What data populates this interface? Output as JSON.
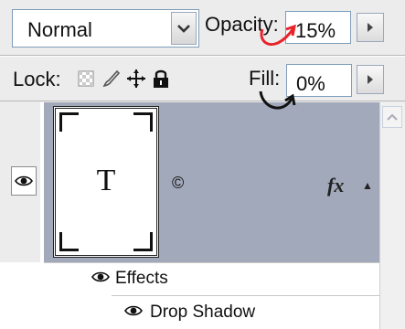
{
  "blend_mode": {
    "value": "Normal"
  },
  "opacity": {
    "label": "Opacity:",
    "value": "15%"
  },
  "lock": {
    "label": "Lock:"
  },
  "fill": {
    "label": "Fill:",
    "value": "0%"
  },
  "layer": {
    "thumbnail_text": "T",
    "name": "©",
    "fx_badge": "fx"
  },
  "effects": {
    "label": "Effects"
  },
  "drop_shadow": {
    "label": "Drop Shadow"
  },
  "colors": {
    "layer_selected": "#a2a9ba",
    "annotation_red": "#e8232a",
    "annotation_black": "#111111"
  },
  "icons": [
    "chevron-down-icon",
    "stepper-arrow-icon",
    "lock-transparent-icon",
    "lock-image-brush-icon",
    "lock-position-move-icon",
    "lock-all-padlock-icon",
    "eye-icon",
    "scroll-up-icon"
  ]
}
